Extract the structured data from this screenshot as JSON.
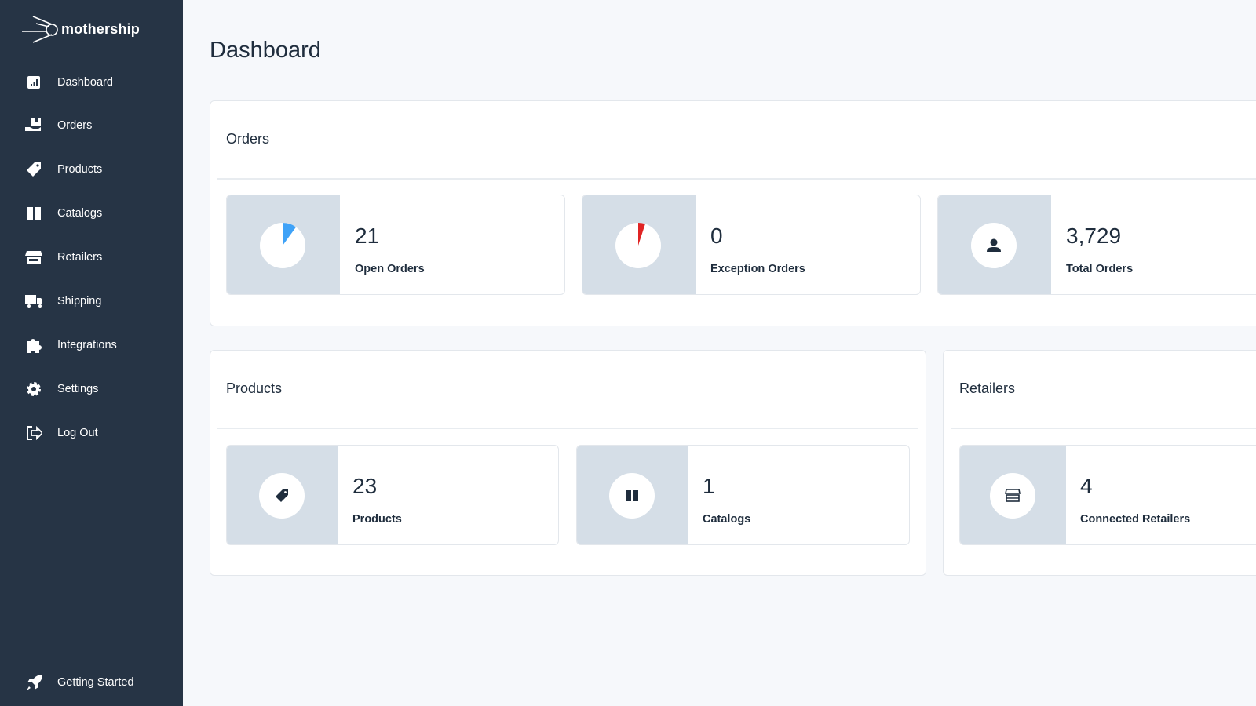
{
  "brand": {
    "name": "mothership"
  },
  "sidebar": {
    "items": [
      {
        "label": "Dashboard",
        "icon": "bar-chart-icon"
      },
      {
        "label": "Orders",
        "icon": "box-hand-icon"
      },
      {
        "label": "Products",
        "icon": "tag-icon"
      },
      {
        "label": "Catalogs",
        "icon": "book-icon"
      },
      {
        "label": "Retailers",
        "icon": "store-icon"
      },
      {
        "label": "Shipping",
        "icon": "truck-icon"
      },
      {
        "label": "Integrations",
        "icon": "puzzle-icon"
      },
      {
        "label": "Settings",
        "icon": "gear-icon"
      },
      {
        "label": "Log Out",
        "icon": "logout-icon"
      }
    ],
    "footer": {
      "label": "Getting Started",
      "icon": "rocket-icon"
    }
  },
  "page": {
    "title": "Dashboard"
  },
  "orders": {
    "title": "Orders",
    "stats": [
      {
        "value": "21",
        "label": "Open Orders",
        "icon": "pie-icon",
        "pie_fraction": 0.1,
        "color": "#3fa2f7"
      },
      {
        "value": "0",
        "label": "Exception Orders",
        "icon": "pie-icon",
        "pie_fraction": 0.05,
        "color": "#e02424"
      },
      {
        "value": "3,729",
        "label": "Total Orders",
        "icon": "user-icon"
      }
    ]
  },
  "products": {
    "title": "Products",
    "stats": [
      {
        "value": "23",
        "label": "Products",
        "icon": "tag-icon"
      },
      {
        "value": "1",
        "label": "Catalogs",
        "icon": "book-icon"
      }
    ]
  },
  "retailers": {
    "title": "Retailers",
    "stats": [
      {
        "value": "4",
        "label": "Connected Retailers",
        "icon": "store-icon"
      }
    ]
  },
  "colors": {
    "sidebar": "#263445",
    "icon_bg": "#d5dee7",
    "background": "#f6f8fb"
  }
}
